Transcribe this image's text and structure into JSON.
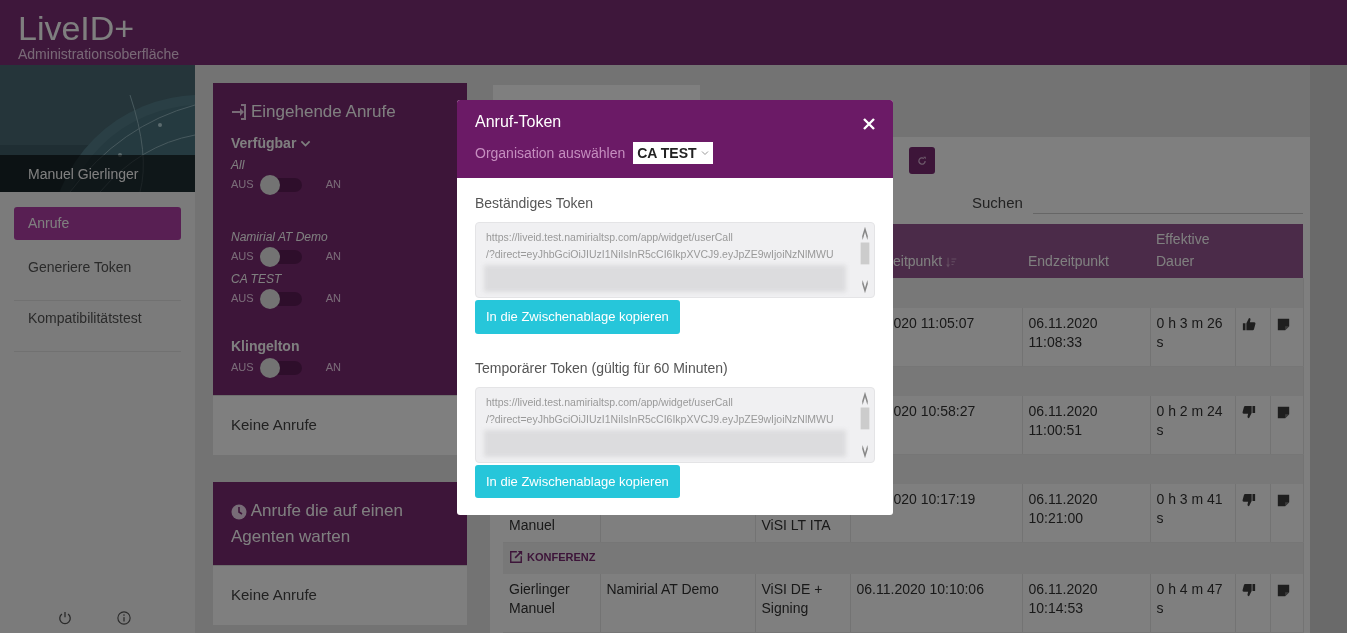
{
  "header": {
    "logo": "LiveID+",
    "subtitle": "Administrationsoberfläche"
  },
  "sidebar": {
    "user_name": "Manuel Gierlinger",
    "items": [
      {
        "label": "Anrufe",
        "selected": true
      },
      {
        "label": "Generiere Token",
        "selected": false
      },
      {
        "label": "Kompatibilitätstest",
        "selected": false
      }
    ]
  },
  "incoming_calls": {
    "title": "Eingehende Anrufe",
    "availability": "Verfügbar",
    "toggles": [
      {
        "kind": "all",
        "label": "All",
        "off_label": "AUS",
        "on_label": "AN",
        "on": false
      },
      {
        "kind": "organization",
        "label": "Namirial AT Demo",
        "off_label": "AUS",
        "on_label": "AN",
        "on": false
      },
      {
        "kind": "organization",
        "label": "CA TEST",
        "off_label": "AUS",
        "on_label": "AN",
        "on": false
      },
      {
        "kind": "ringtone",
        "label": "Klingelton",
        "off_label": "AUS",
        "on_label": "AN",
        "on": false
      }
    ],
    "empty_text": "Keine Anrufe"
  },
  "waiting_calls": {
    "title": "Anrufe die auf einen Agenten warten",
    "empty_text": "Keine Anrufe"
  },
  "calls_table": {
    "search_label": "Suchen",
    "columns": {
      "start": {
        "label": "eitpunkt",
        "sortable": true
      },
      "end": {
        "label": "Endzeitpunkt",
        "sortable": false
      },
      "duration": {
        "label": "Effektive Dauer",
        "sortable": false
      }
    },
    "rows": [
      {
        "kind": "group"
      },
      {
        "kind": "call",
        "covered": true,
        "start": "020 11:05:07",
        "end": "06.11.2020 11:08:33",
        "duration": "0 h 3 m 26 s",
        "positive": true
      },
      {
        "kind": "group"
      },
      {
        "kind": "call",
        "covered": true,
        "start": "020 10:58:27",
        "end": "06.11.2020 11:00:51",
        "duration": "0 h 2 m 24 s",
        "positive": false
      },
      {
        "kind": "group"
      },
      {
        "kind": "call",
        "covered": true,
        "contact": "Manuel",
        "service": "ViSI LT ITA",
        "start": "020 10:17:19",
        "end": "06.11.2020 10:21:00",
        "duration": "0 h 3 m 41 s",
        "positive": false
      },
      {
        "kind": "group",
        "label": "KONFERENZ"
      },
      {
        "kind": "call",
        "covered": false,
        "contact": "Gierlinger Manuel",
        "organization": "Namirial AT Demo",
        "service": "ViSI DE + Signing",
        "start": "06.11.2020 10:10:06",
        "end": "06.11.2020 10:14:53",
        "duration": "0 h 4 m 47 s",
        "positive": false
      }
    ]
  },
  "modal": {
    "title": "Anruf-Token",
    "org_label": "Organisation auswählen",
    "org_value": "CA TEST",
    "sections": [
      {
        "label": "Beständiges Token",
        "lines": [
          "https://liveid.test.namirialtsp.com/app/widget/userCall",
          "/?direct=eyJhbGciOiJIUzI1NiIsInR5cCI6IkpXVCJ9.eyJpZE9wIjoiNzNlMWU"
        ],
        "button": "In die Zwischenablage kopieren"
      },
      {
        "label": "Temporärer Token (gültig für 60 Minuten)",
        "lines": [
          "https://liveid.test.namirialtsp.com/app/widget/userCall",
          "/?direct=eyJhbGciOiJIUzI1NiIsInR5cCI6IkpXVCJ9.eyJpZE9wIjoiNzNlMWU"
        ],
        "button": "In die Zwischenablage kopieren"
      }
    ]
  }
}
